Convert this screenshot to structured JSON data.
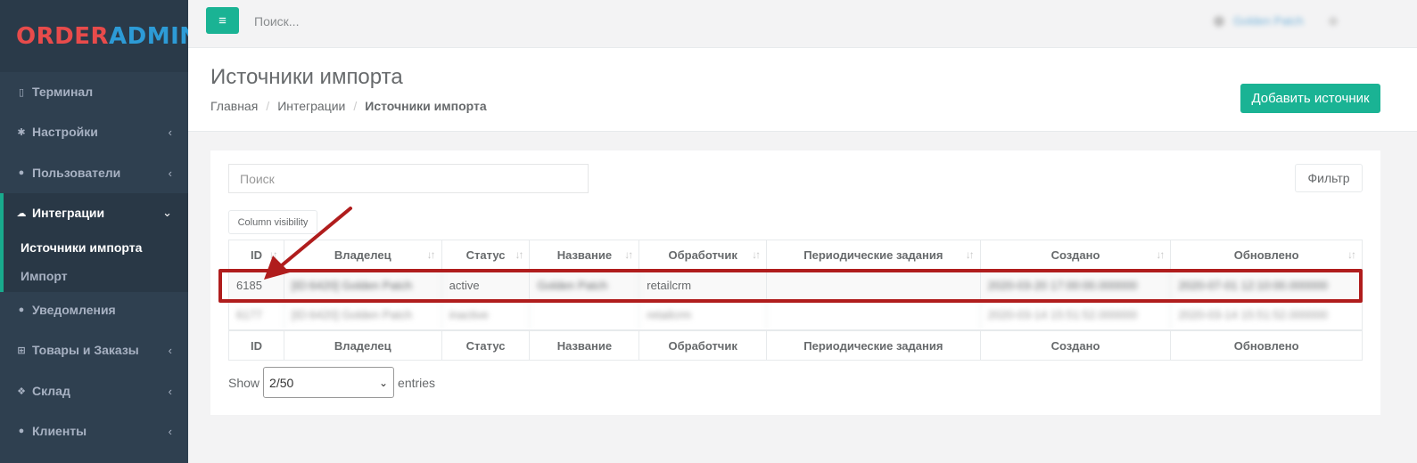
{
  "sidebar": {
    "logo_part1": "ORDER",
    "logo_part2": "ADMIN",
    "items": [
      {
        "label": "Терминал"
      },
      {
        "label": "Настройки"
      },
      {
        "label": "Пользователи"
      },
      {
        "label": "Интеграции"
      },
      {
        "label": "Уведомления"
      },
      {
        "label": "Товары и Заказы"
      },
      {
        "label": "Склад"
      },
      {
        "label": "Клиенты"
      }
    ],
    "subitems": [
      {
        "label": "Источники импорта"
      },
      {
        "label": "Импорт"
      }
    ]
  },
  "topbar": {
    "search_placeholder": "Поиск...",
    "user_name": "Golden Patch"
  },
  "page": {
    "title": "Источники импорта",
    "breadcrumb": [
      "Главная",
      "Интеграции",
      "Источники импорта"
    ],
    "add_button": "Добавить источник"
  },
  "toolbar": {
    "search_placeholder": "Поиск",
    "filter_button": "Фильтр",
    "column_visibility": "Column visibility"
  },
  "table": {
    "columns": [
      "ID",
      "Владелец",
      "Статус",
      "Название",
      "Обработчик",
      "Периодические задания",
      "Создано",
      "Обновлено"
    ],
    "rows": [
      {
        "id": "6185",
        "owner": "[ID:6420] Golden Patch",
        "status": "active",
        "name": "Golden Patch",
        "handler": "retailcrm",
        "tasks": "",
        "created": "2020-03-20 17:00:00.000000",
        "updated": "2020-07-01 12:10:00.000000"
      },
      {
        "id": "6177",
        "owner": "[ID:6420] Golden Patch",
        "status": "inactive",
        "name": "",
        "handler": "retailcrm",
        "tasks": "",
        "created": "2020-03-14 15:51:52.000000",
        "updated": "2020-03-14 15:51:52.000000"
      }
    ]
  },
  "pagination": {
    "show_label": "Show",
    "selected": "2/50",
    "entries_label": "entries"
  },
  "colors": {
    "accent": "#1ab394",
    "sidebar": "#2f4050",
    "highlight": "#b01d1d"
  }
}
